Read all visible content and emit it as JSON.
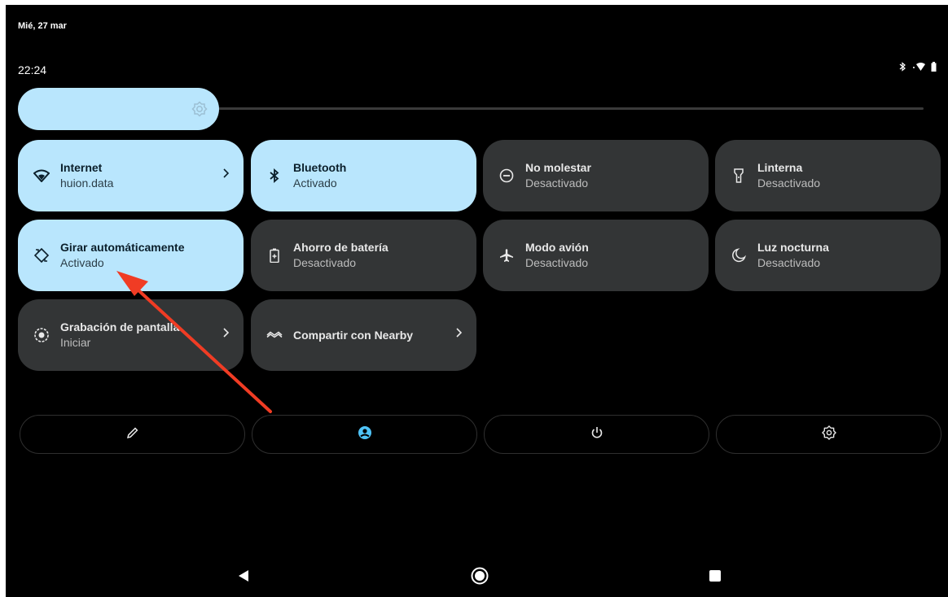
{
  "status_bar": {
    "date": "Mié, 27 mar",
    "time": "22:24",
    "icons": [
      "bluetooth-icon",
      "wifi-icon",
      "battery-icon"
    ]
  },
  "brightness": {
    "level": 0.27,
    "icon": "brightness-icon"
  },
  "tiles": [
    {
      "title": "Internet",
      "subtitle": "huion.data",
      "state": "on",
      "icon": "wifi-icon",
      "chevron": true
    },
    {
      "title": "Bluetooth",
      "subtitle": "Activado",
      "state": "on",
      "icon": "bluetooth-icon",
      "chevron": false
    },
    {
      "title": "No molestar",
      "subtitle": "Desactivado",
      "state": "off",
      "icon": "do-not-disturb-icon",
      "chevron": false
    },
    {
      "title": "Linterna",
      "subtitle": "Desactivado",
      "state": "off",
      "icon": "flashlight-icon",
      "chevron": false
    },
    {
      "title": "Girar automáticamente",
      "subtitle": "Activado",
      "state": "on",
      "icon": "auto-rotate-icon",
      "chevron": false
    },
    {
      "title": "Ahorro de batería",
      "subtitle": "Desactivado",
      "state": "off",
      "icon": "battery-saver-icon",
      "chevron": false
    },
    {
      "title": "Modo avión",
      "subtitle": "Desactivado",
      "state": "off",
      "icon": "airplane-icon",
      "chevron": false
    },
    {
      "title": "Luz nocturna",
      "subtitle": "Desactivado",
      "state": "off",
      "icon": "night-light-icon",
      "chevron": false
    },
    {
      "title": "Grabación de pantalla",
      "subtitle": "Iniciar",
      "state": "off",
      "icon": "screen-record-icon",
      "chevron": true
    },
    {
      "title": "Compartir con Nearby",
      "subtitle": "",
      "state": "off",
      "icon": "nearby-share-icon",
      "chevron": true
    }
  ],
  "footer_buttons": [
    "edit-icon",
    "user-icon",
    "power-icon",
    "settings-icon"
  ],
  "nav_bar": [
    "back-icon",
    "home-icon",
    "recents-icon"
  ],
  "colors": {
    "tile_on": "#b9e6fd",
    "tile_off": "#333536",
    "accent": "#4fc3f7",
    "annotation_arrow": "#f03c24"
  }
}
